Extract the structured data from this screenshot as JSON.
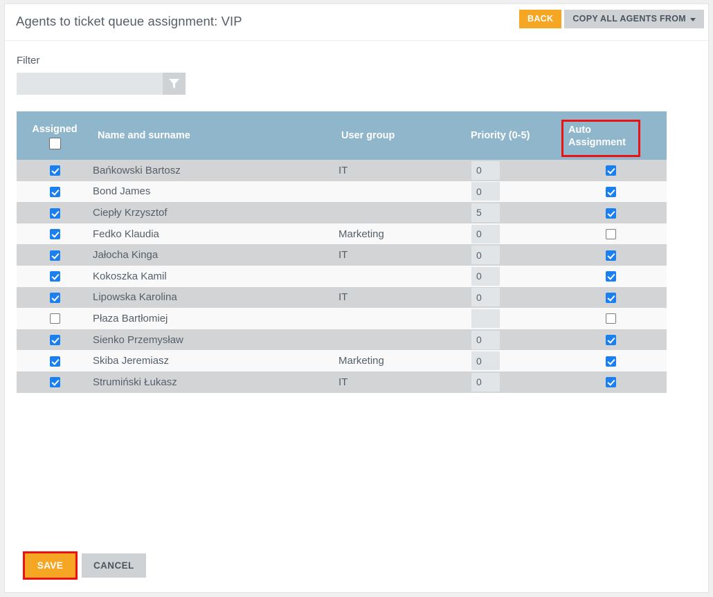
{
  "header": {
    "title": "Agents to ticket queue assignment: VIP",
    "back_label": "BACK",
    "copy_label": "COPY ALL AGENTS FROM",
    "caret_icon": "chevron-down-icon"
  },
  "filter": {
    "label": "Filter",
    "value": "",
    "placeholder": "",
    "button_icon": "funnel-icon"
  },
  "table": {
    "columns": {
      "assigned": "Assigned",
      "name": "Name and surname",
      "group": "User group",
      "priority": "Priority (0-5)",
      "auto": "Auto Assignment"
    },
    "header_select_all_checked": false,
    "rows": [
      {
        "assigned": true,
        "name": "Bańkowski Bartosz",
        "group": "IT",
        "priority": "0",
        "auto": true
      },
      {
        "assigned": true,
        "name": "Bond James",
        "group": "",
        "priority": "0",
        "auto": true
      },
      {
        "assigned": true,
        "name": "Ciepły Krzysztof",
        "group": "",
        "priority": "5",
        "auto": true
      },
      {
        "assigned": true,
        "name": "Fedko Klaudia",
        "group": "Marketing",
        "priority": "0",
        "auto": false
      },
      {
        "assigned": true,
        "name": "Jałocha Kinga",
        "group": "IT",
        "priority": "0",
        "auto": true
      },
      {
        "assigned": true,
        "name": "Kokoszka Kamil",
        "group": "",
        "priority": "0",
        "auto": true
      },
      {
        "assigned": true,
        "name": "Lipowska Karolina",
        "group": "IT",
        "priority": "0",
        "auto": true
      },
      {
        "assigned": false,
        "name": "Płaza Bartłomiej",
        "group": "",
        "priority": "",
        "auto": false
      },
      {
        "assigned": true,
        "name": "Sienko Przemysław",
        "group": "",
        "priority": "0",
        "auto": true
      },
      {
        "assigned": true,
        "name": "Skiba Jeremiasz",
        "group": "Marketing",
        "priority": "0",
        "auto": true
      },
      {
        "assigned": true,
        "name": "Strumiński Łukasz",
        "group": "IT",
        "priority": "0",
        "auto": true
      }
    ]
  },
  "footer": {
    "save_label": "SAVE",
    "cancel_label": "CANCEL"
  },
  "colors": {
    "accent_orange": "#f5a623",
    "table_header_teal": "#8fb6cb",
    "highlight_red": "#ee1111",
    "checkbox_blue": "#1a7ff0"
  }
}
